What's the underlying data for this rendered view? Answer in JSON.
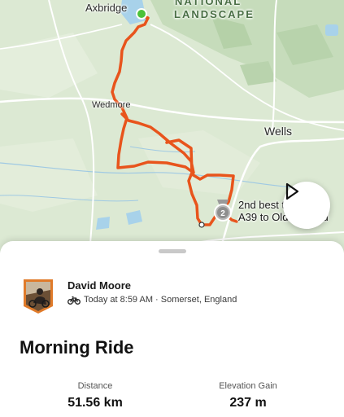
{
  "map": {
    "places": {
      "axbridge": "Axbridge",
      "national_line1": "NATIONAL",
      "national_line2": "LANDSCAPE",
      "wedmore": "Wedmore",
      "wells": "Wells"
    },
    "segment_label_line1": "2nd best t",
    "segment_label_line2": "A39 to Old",
    "segment_label_suffix": "d",
    "medal_rank": "2",
    "route_color": "#e8541c",
    "start_color": "#4cc23a"
  },
  "controls": {
    "play_icon": "play-icon"
  },
  "activity": {
    "athlete_name": "David Moore",
    "sport_icon": "bike-icon",
    "timestamp_location": "Today at 8:59 AM · Somerset, England",
    "title": "Morning Ride",
    "stats": [
      {
        "label": "Distance",
        "value": "51.56 km"
      },
      {
        "label": "Elevation Gain",
        "value": "237 m"
      }
    ]
  }
}
